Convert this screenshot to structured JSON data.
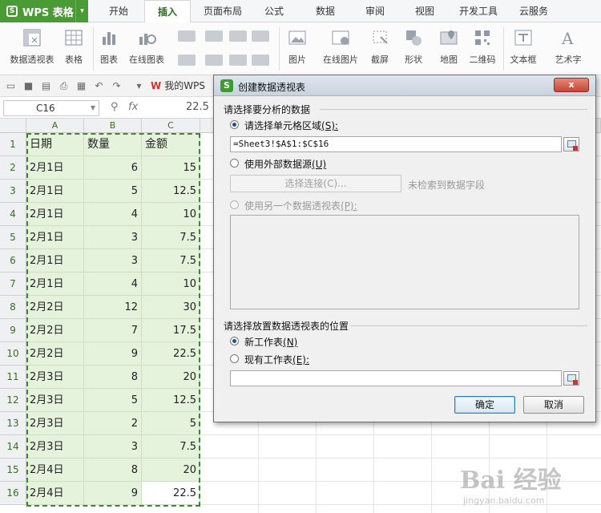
{
  "menubar": {
    "app_name": "WPS 表格",
    "tabs": [
      "开始",
      "插入",
      "页面布局",
      "公式",
      "数据",
      "审阅",
      "视图",
      "开发工具",
      "云服务"
    ],
    "active_tab": "插入"
  },
  "ribbon": {
    "buttons": [
      {
        "label": "数据透视表",
        "icon": "pivot-table-icon"
      },
      {
        "label": "表格",
        "icon": "table-icon"
      },
      {
        "label": "图表",
        "icon": "chart-icon"
      },
      {
        "label": "在线图表",
        "icon": "online-chart-icon"
      },
      {
        "label": "图片",
        "icon": "picture-icon"
      },
      {
        "label": "在线图片",
        "icon": "online-picture-icon"
      },
      {
        "label": "截屏",
        "icon": "screenshot-icon"
      },
      {
        "label": "形状",
        "icon": "shape-icon"
      },
      {
        "label": "地图",
        "icon": "map-icon"
      },
      {
        "label": "二维码",
        "icon": "qrcode-icon"
      },
      {
        "label": "文本框",
        "icon": "textbox-icon"
      },
      {
        "label": "艺术字",
        "icon": "wordart-icon"
      }
    ]
  },
  "quickbar": {
    "my_wps": "我的WPS"
  },
  "formula_bar": {
    "cell_ref": "C16",
    "fx": "fx",
    "value": "22.5"
  },
  "sheet": {
    "columns": [
      "A",
      "B",
      "C"
    ],
    "headers": [
      "日期",
      "数量",
      "金额"
    ],
    "rows": [
      {
        "n": "1"
      },
      {
        "n": "2",
        "date": "2月1日",
        "qty": "6",
        "amt": "15"
      },
      {
        "n": "3",
        "date": "2月1日",
        "qty": "5",
        "amt": "12.5"
      },
      {
        "n": "4",
        "date": "2月1日",
        "qty": "4",
        "amt": "10"
      },
      {
        "n": "5",
        "date": "2月1日",
        "qty": "3",
        "amt": "7.5"
      },
      {
        "n": "6",
        "date": "2月1日",
        "qty": "3",
        "amt": "7.5"
      },
      {
        "n": "7",
        "date": "2月1日",
        "qty": "4",
        "amt": "10"
      },
      {
        "n": "8",
        "date": "2月2日",
        "qty": "12",
        "amt": "30"
      },
      {
        "n": "9",
        "date": "2月2日",
        "qty": "7",
        "amt": "17.5"
      },
      {
        "n": "10",
        "date": "2月2日",
        "qty": "9",
        "amt": "22.5"
      },
      {
        "n": "11",
        "date": "2月3日",
        "qty": "8",
        "amt": "20"
      },
      {
        "n": "12",
        "date": "2月3日",
        "qty": "5",
        "amt": "12.5"
      },
      {
        "n": "13",
        "date": "2月3日",
        "qty": "2",
        "amt": "5"
      },
      {
        "n": "14",
        "date": "2月3日",
        "qty": "3",
        "amt": "7.5"
      },
      {
        "n": "15",
        "date": "2月4日",
        "qty": "8",
        "amt": "20"
      },
      {
        "n": "16",
        "date": "2月4日",
        "qty": "9",
        "amt": "22.5"
      }
    ]
  },
  "dialog": {
    "title": "创建数据透视表",
    "close_label": "x",
    "section1": "请选择要分析的数据",
    "opt_range": "请选择单元格区域",
    "opt_range_key": "(S):",
    "range_value": "=Sheet3!$A$1:$C$16",
    "opt_external": "使用外部数据源",
    "opt_external_key": "(U)",
    "choose_conn": "选择连接(C)...",
    "no_fields": "未检索到数据字段",
    "opt_other_pivot": "使用另一个数据透视表",
    "opt_other_pivot_key": "(P):",
    "section2": "请选择放置数据透视表的位置",
    "opt_new_sheet": "新工作表",
    "opt_new_sheet_key": "(N)",
    "opt_existing": "现有工作表",
    "opt_existing_key": "(E):",
    "existing_value": "",
    "ok": "确定",
    "cancel": "取消"
  },
  "watermark": {
    "main": "Bai 经验",
    "sub": "jingyan.baidu.com"
  },
  "colors": {
    "brand_green": "#4a9a36",
    "selection_fill": "#e5f2dc",
    "marquee": "#3c8a2a",
    "close_red": "#c54634"
  }
}
